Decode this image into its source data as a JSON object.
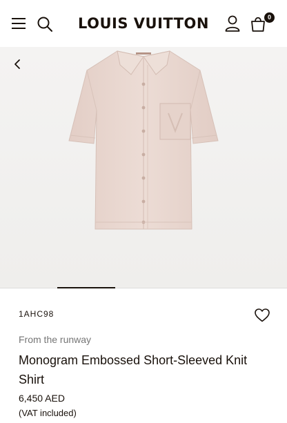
{
  "header": {
    "brand": "LOUIS VUITTON",
    "bag_count": "0",
    "icons": [
      "menu-icon",
      "search-icon",
      "account-icon",
      "shopping-bag-icon"
    ]
  },
  "gallery": {
    "back_icon": "chevron-left-icon",
    "active_image_index": 1
  },
  "product": {
    "sku": "1AHC98",
    "tagline": "From the runway",
    "name": "Monogram Embossed Short-Sleeved Knit Shirt",
    "price": "6,450 AED",
    "vat_note": "(VAT included)",
    "wishlist_icon": "heart-icon"
  },
  "colors": {
    "text": "#19110b",
    "muted": "#757575",
    "gallery_bg": "#f2f1f0",
    "shirt": "#e8d6ce"
  }
}
